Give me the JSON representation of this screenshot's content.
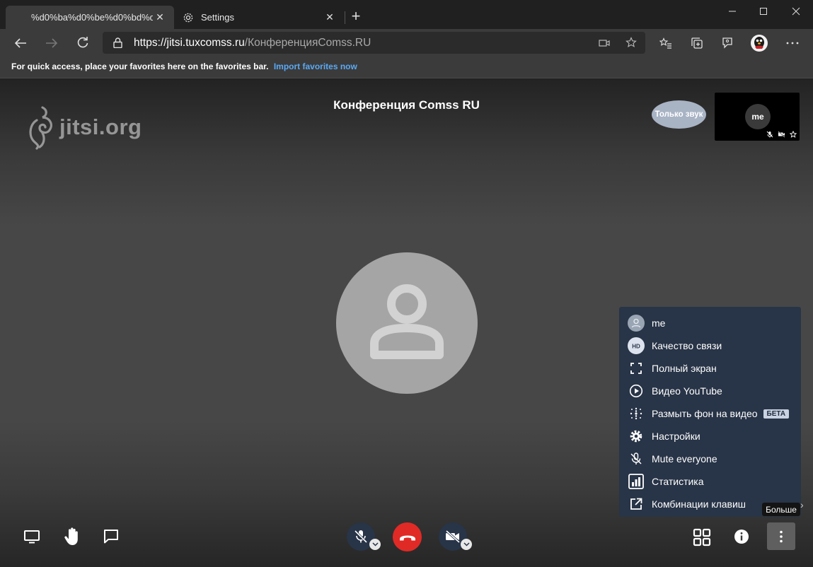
{
  "browser": {
    "tabs": [
      {
        "title": "%d0%ba%d0%be%d0%bd%d1%",
        "active": true
      },
      {
        "title": "Settings",
        "active": false
      }
    ],
    "address": {
      "host": "https://jitsi.tuxcomss.ru",
      "path": "/КонференцияComss.RU"
    },
    "favorites_bar": {
      "text": "For quick access, place your favorites here on the favorites bar.",
      "link": "Import favorites now"
    }
  },
  "conference": {
    "watermark": "jitsi.org",
    "title": "Конференция Comss RU",
    "audio_only_label": "Только звук",
    "self_view": {
      "initials": "me"
    }
  },
  "overflow_menu": {
    "items": [
      {
        "label": "me",
        "icon": "avatar-icon"
      },
      {
        "label": "Качество связи",
        "icon": "hd-icon"
      },
      {
        "label": "Полный экран",
        "icon": "fullscreen-icon"
      },
      {
        "label": "Видео YouTube",
        "icon": "play-icon"
      },
      {
        "label": "Размыть фон на видео",
        "icon": "blur-icon",
        "badge": "БЕТА"
      },
      {
        "label": "Настройки",
        "icon": "gear-icon"
      },
      {
        "label": "Mute everyone",
        "icon": "mic-off-icon"
      },
      {
        "label": "Статистика",
        "icon": "stats-icon"
      },
      {
        "label": "Комбинации клавиш",
        "icon": "external-link-icon"
      }
    ],
    "tooltip": "Больше"
  },
  "colors": {
    "hangup": "#e02a26",
    "menu_bg": "#283447",
    "stage": "#474747"
  }
}
